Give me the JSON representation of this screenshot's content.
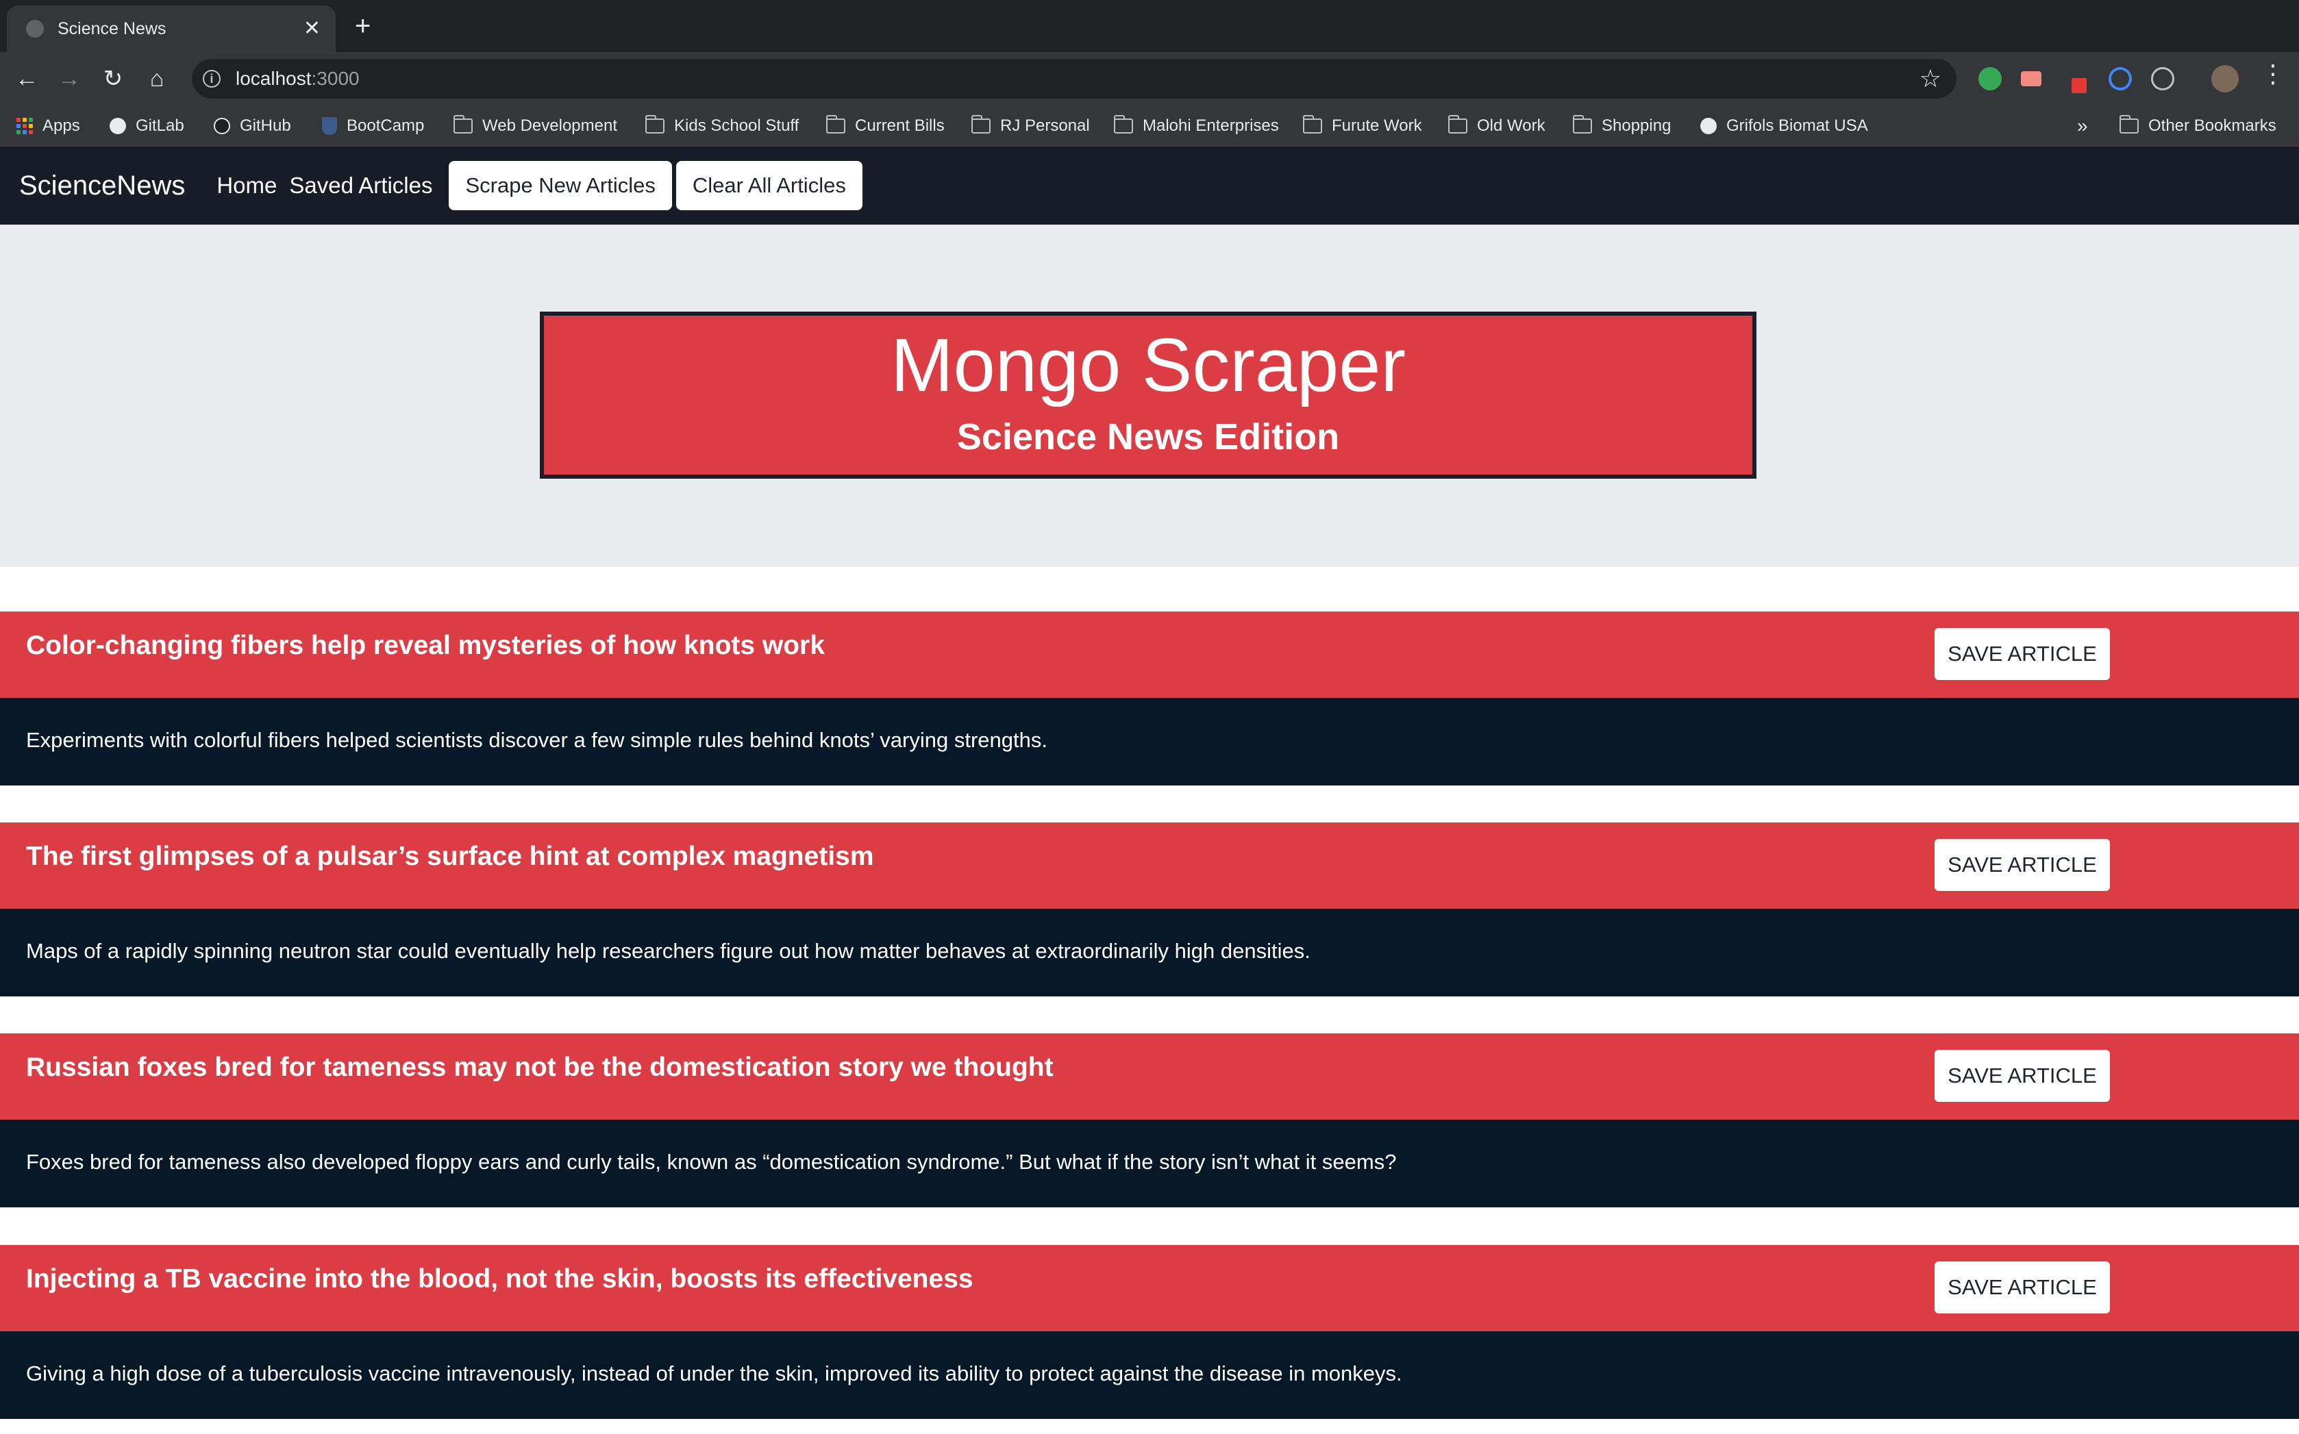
{
  "browser": {
    "tab_title": "Science News",
    "url_host": "localhost",
    "url_port": ":3000",
    "bookmarks": [
      {
        "label": "Apps",
        "icon": "apps-icon"
      },
      {
        "label": "GitLab",
        "icon": "globe-icon"
      },
      {
        "label": "GitHub",
        "icon": "github-icon"
      },
      {
        "label": "BootCamp",
        "icon": "shield-icon"
      },
      {
        "label": "Web Development",
        "icon": "folder-icon"
      },
      {
        "label": "Kids School Stuff",
        "icon": "folder-icon"
      },
      {
        "label": "Current Bills",
        "icon": "folder-icon"
      },
      {
        "label": "RJ Personal",
        "icon": "folder-icon"
      },
      {
        "label": "Malohi Enterprises",
        "icon": "folder-icon"
      },
      {
        "label": "Furute Work",
        "icon": "folder-icon"
      },
      {
        "label": "Old Work",
        "icon": "folder-icon"
      },
      {
        "label": "Shopping",
        "icon": "folder-icon"
      },
      {
        "label": "Grifols Biomat USA",
        "icon": "globe-icon"
      }
    ],
    "overflow": "»",
    "other_bookmarks": "Other Bookmarks"
  },
  "nav": {
    "brand": "ScienceNews",
    "home": "Home",
    "saved": "Saved Articles",
    "scrape": "Scrape New Articles",
    "clear": "Clear All Articles"
  },
  "hero": {
    "title": "Mongo Scraper",
    "subtitle": "Science News Edition"
  },
  "articles": [
    {
      "title": "Color-changing fibers help reveal mysteries of how knots work",
      "summary": "Experiments with colorful fibers helped scientists discover a few simple rules behind knots’ varying strengths.",
      "button": "SAVE ARTICLE"
    },
    {
      "title": "The first glimpses of a pulsar’s surface hint at complex magnetism",
      "summary": "Maps of a rapidly spinning neutron star could eventually help researchers figure out how matter behaves at extraordinarily high densities.",
      "button": "SAVE ARTICLE"
    },
    {
      "title": "Russian foxes bred for tameness may not be the domestication story we thought",
      "summary": "Foxes bred for tameness also developed floppy ears and curly tails, known as “domestication syndrome.” But what if the story isn’t what it seems?",
      "button": "SAVE ARTICLE"
    },
    {
      "title": "Injecting a TB vaccine into the blood, not the skin, boosts its effectiveness",
      "summary": "Giving a high dose of a tuberculosis vaccine intravenously, instead of under the skin, improved its ability to protect against the disease in monkeys.",
      "button": "SAVE ARTICLE"
    }
  ],
  "colors": {
    "accent_red": "#dc3c43",
    "navbar": "#171c27",
    "card_body": "#061827",
    "jumbotron": "#e9ecef"
  }
}
